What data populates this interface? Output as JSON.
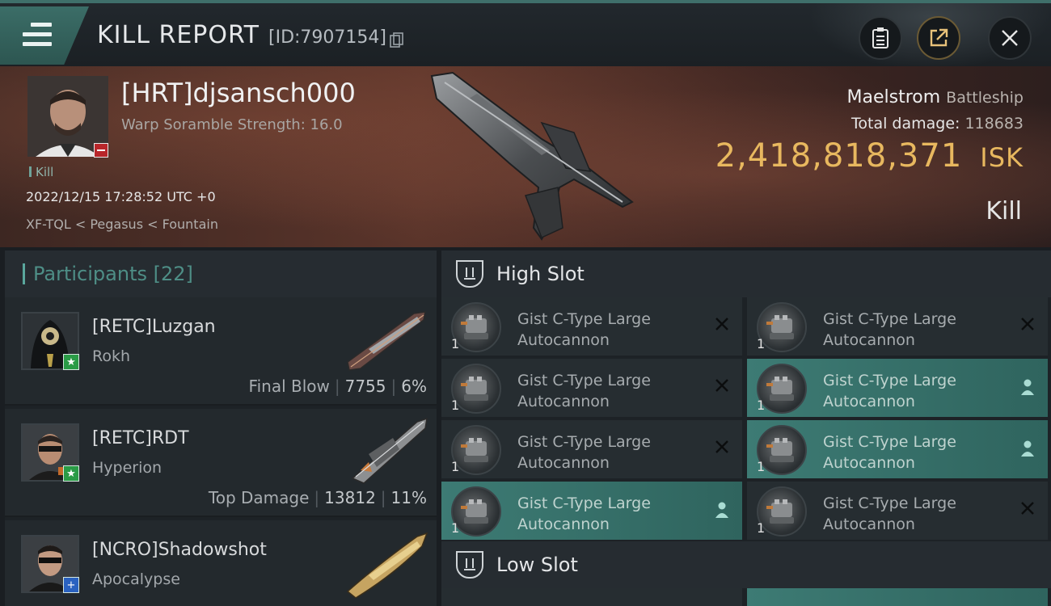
{
  "header": {
    "title": "KILL REPORT",
    "id_label": "[ID:7907154]"
  },
  "victim": {
    "name": "[HRT]djsansch000",
    "warp_scramble": "Warp Soramble Strength: 16.0",
    "tag": "Kill",
    "datetime": "2022/12/15 17:28:52 UTC +0",
    "location": "XF-TQL < Pegasus < Fountain",
    "ship_name": "Maelstrom",
    "ship_class": "Battleship",
    "total_damage_label": "Total damage:",
    "total_damage_value": "118683",
    "isk_value": "2,418,818,371",
    "isk_unit": "ISK",
    "result": "Kill"
  },
  "participants": {
    "label": "Participants",
    "count": "[22]",
    "items": [
      {
        "name": "[RETC]Luzgan",
        "ship": "Rokh",
        "role": "Final Blow",
        "damage": "7755",
        "percent": "6%",
        "badge": "green"
      },
      {
        "name": "[RETC]RDT",
        "ship": "Hyperion",
        "role": "Top Damage",
        "damage": "13812",
        "percent": "11%",
        "badge": "green"
      },
      {
        "name": "[NCRO]Shadowshot",
        "ship": "Apocalypse",
        "role": "",
        "damage": "",
        "percent": "",
        "badge": "blue"
      }
    ]
  },
  "high_slot": {
    "title": "High Slot",
    "modules": [
      {
        "line1": "Gist C-Type Large",
        "line2": "Autocannon",
        "qty": "1",
        "status": "destroyed"
      },
      {
        "line1": "Gist C-Type Large",
        "line2": "Autocannon",
        "qty": "1",
        "status": "destroyed"
      },
      {
        "line1": "Gist C-Type Large",
        "line2": "Autocannon",
        "qty": "1",
        "status": "destroyed"
      },
      {
        "line1": "Gist C-Type Large",
        "line2": "Autocannon",
        "qty": "1",
        "status": "dropped"
      },
      {
        "line1": "Gist C-Type Large",
        "line2": "Autocannon",
        "qty": "1",
        "status": "destroyed"
      },
      {
        "line1": "Gist C-Type Large",
        "line2": "Autocannon",
        "qty": "1",
        "status": "dropped"
      },
      {
        "line1": "Gist C-Type Large",
        "line2": "Autocannon",
        "qty": "1",
        "status": "dropped"
      },
      {
        "line1": "Gist C-Type Large",
        "line2": "Autocannon",
        "qty": "1",
        "status": "destroyed"
      }
    ]
  },
  "low_slot": {
    "title": "Low Slot"
  },
  "colors": {
    "accent_teal": "#3d7b74",
    "isk_gold": "#e8b85f",
    "badge_red": "#b8262a",
    "badge_green": "#2a9b46",
    "badge_blue": "#2a62c0"
  }
}
